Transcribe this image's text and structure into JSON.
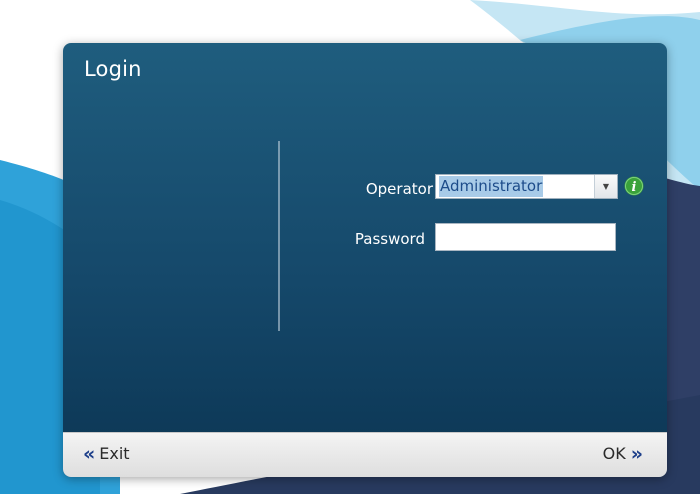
{
  "dialog": {
    "title": "Login"
  },
  "form": {
    "operator_label": "Operator",
    "operator_value": "Administrator",
    "password_label": "Password",
    "password_value": ""
  },
  "footer": {
    "exit_label": "Exit",
    "ok_label": "OK"
  },
  "icons": {
    "exit": "double-chevron-left-icon",
    "ok": "double-chevron-right-icon",
    "info": "info-icon",
    "dropdown": "chevron-down-icon"
  },
  "colors": {
    "dialog_top": "#1f5d7e",
    "dialog_bottom": "#0b3553",
    "selection_highlight": "#a8cbe8",
    "info_green": "#3aa23a",
    "chevron_blue": "#1d3f8a"
  }
}
